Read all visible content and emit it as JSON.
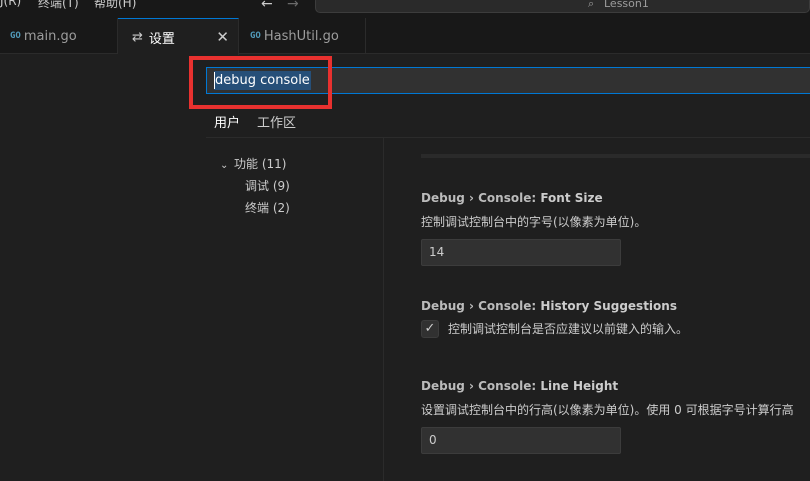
{
  "menubar": {
    "items": [
      "J(R)",
      "终端(T)",
      "帮助(H)"
    ],
    "back_icon": "arrow-left-icon",
    "forward_icon": "arrow-right-icon",
    "command_center_text": "Lesson1"
  },
  "tabs": [
    {
      "label": "main.go",
      "icon": "go-file-icon"
    },
    {
      "label": "设置",
      "icon": "settings-icon",
      "active": true
    },
    {
      "label": "HashUtil.go",
      "icon": "go-file-icon"
    }
  ],
  "search": {
    "value": "debug console"
  },
  "scopes": [
    "用户",
    "工作区"
  ],
  "toc": [
    {
      "label": "功能 (11)",
      "expanded": true
    },
    {
      "label": "调试 (9)"
    },
    {
      "label": "终端 (2)"
    }
  ],
  "settings": [
    {
      "category": "Debug › Console: ",
      "name": "Font Size",
      "description": "控制调试控制台中的字号(以像素为单位)。",
      "value": "14"
    },
    {
      "category": "Debug › Console: ",
      "name": "History Suggestions",
      "description": "控制调试控制台是否应建议以前键入的输入。",
      "checked": true
    },
    {
      "category": "Debug › Console: ",
      "name": "Line Height",
      "description": "设置调试控制台中的行高(以像素为单位)。使用 0 可根据字号计算行高",
      "value": "0"
    }
  ],
  "colors": {
    "accent": "#0078d4",
    "highlight_box": "#e8312f",
    "background": "#1f1f1f"
  }
}
